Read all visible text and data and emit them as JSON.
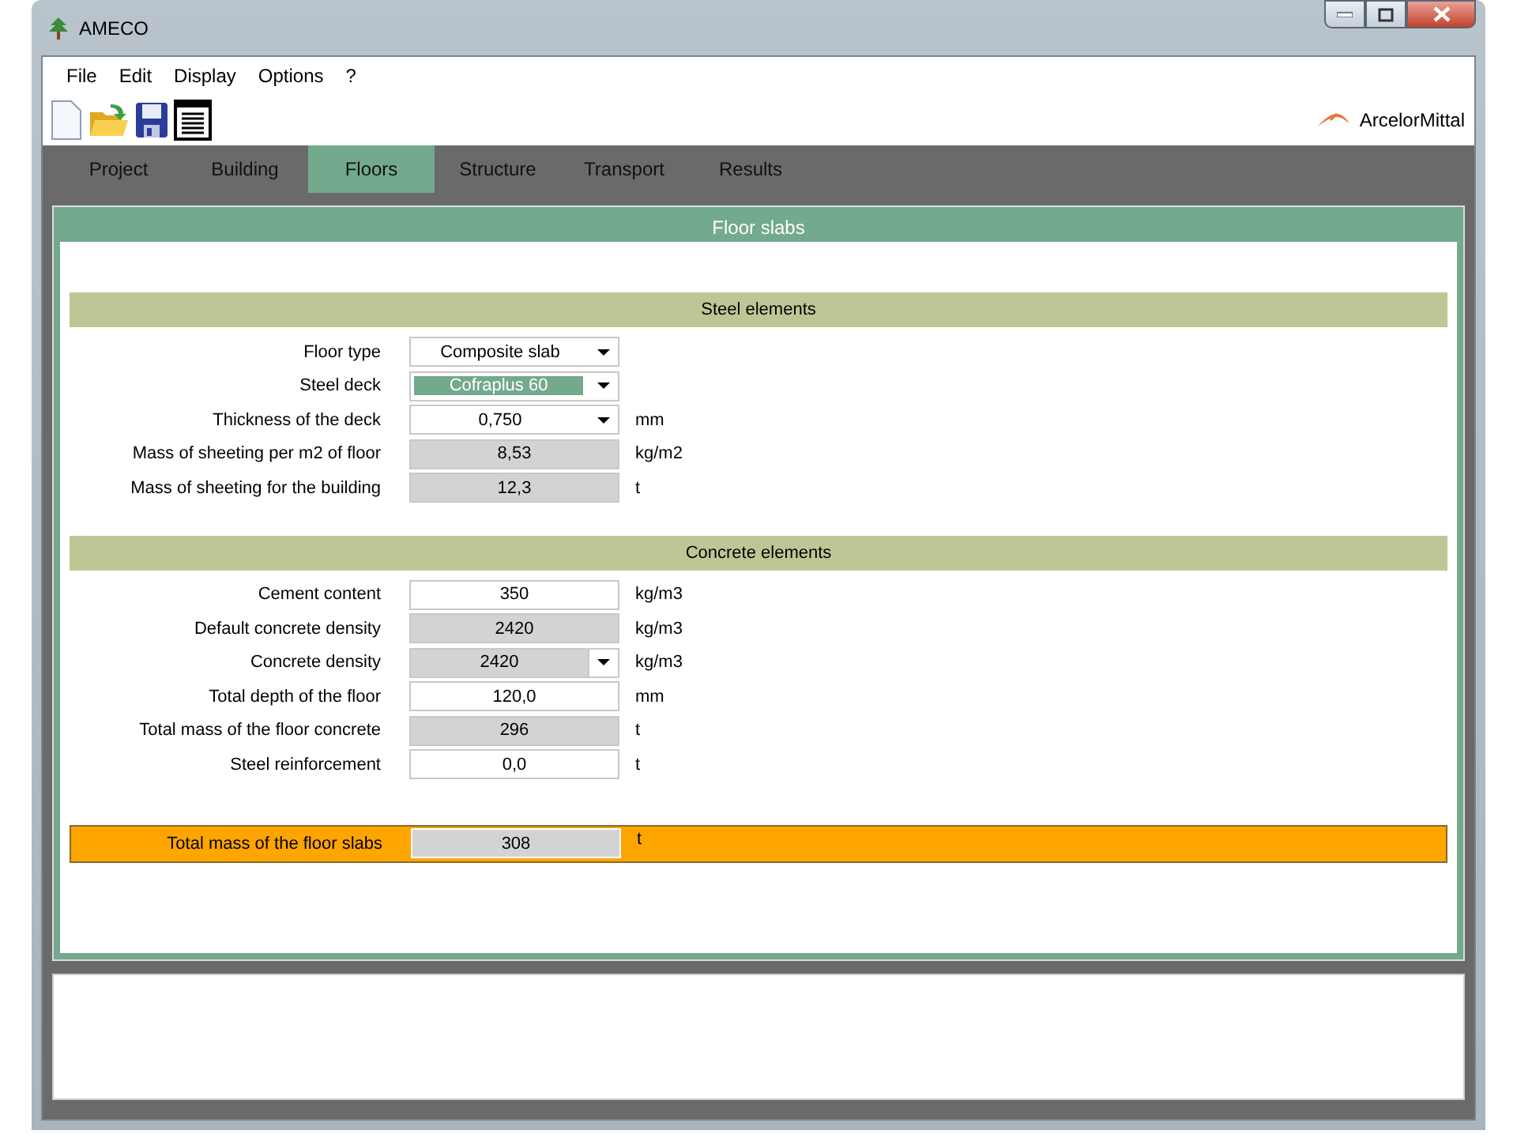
{
  "window": {
    "title": "AMECO"
  },
  "menu": [
    "File",
    "Edit",
    "Display",
    "Options",
    "?"
  ],
  "brand": "ArcelorMittal",
  "tabs": [
    {
      "label": "Project",
      "selected": false
    },
    {
      "label": "Building",
      "selected": false
    },
    {
      "label": "Floors",
      "selected": true
    },
    {
      "label": "Structure",
      "selected": false
    },
    {
      "label": "Transport",
      "selected": false
    },
    {
      "label": "Results",
      "selected": false
    }
  ],
  "panel_title": "Floor slabs",
  "sections": [
    {
      "title": "Steel elements",
      "fields": [
        {
          "label": "Floor type",
          "value": "Composite slab",
          "kind": "combo",
          "highlighted": false
        },
        {
          "label": "Steel deck",
          "value": "Cofraplus 60",
          "kind": "combo",
          "highlighted": true
        },
        {
          "label": "Thickness of the deck",
          "value": "0,750",
          "unit": "mm",
          "kind": "combo",
          "highlighted": false
        },
        {
          "label": "Mass of sheeting per m2 of floor",
          "value": "8,53",
          "unit": "kg/m2",
          "kind": "output"
        },
        {
          "label": "Mass of sheeting for the building",
          "value": "12,3",
          "unit": "t",
          "kind": "output"
        }
      ]
    },
    {
      "title": "Concrete elements",
      "fields": [
        {
          "label": "Cement content",
          "value": "350",
          "unit": "kg/m3",
          "kind": "input"
        },
        {
          "label": "Default concrete density",
          "value": "2420",
          "unit": "kg/m3",
          "kind": "output"
        },
        {
          "label": "Concrete density",
          "value": "2420",
          "unit": "kg/m3",
          "kind": "combo_output"
        },
        {
          "label": "Total depth of the floor",
          "value": "120,0",
          "unit": "mm",
          "kind": "input"
        },
        {
          "label": "Total mass of the floor concrete",
          "value": "296",
          "unit": "t",
          "kind": "output"
        },
        {
          "label": "Steel reinforcement",
          "value": "0,0",
          "unit": "t",
          "kind": "input"
        }
      ]
    }
  ],
  "total": {
    "label": "Total mass of the floor slabs",
    "value": "308",
    "unit": "t"
  }
}
